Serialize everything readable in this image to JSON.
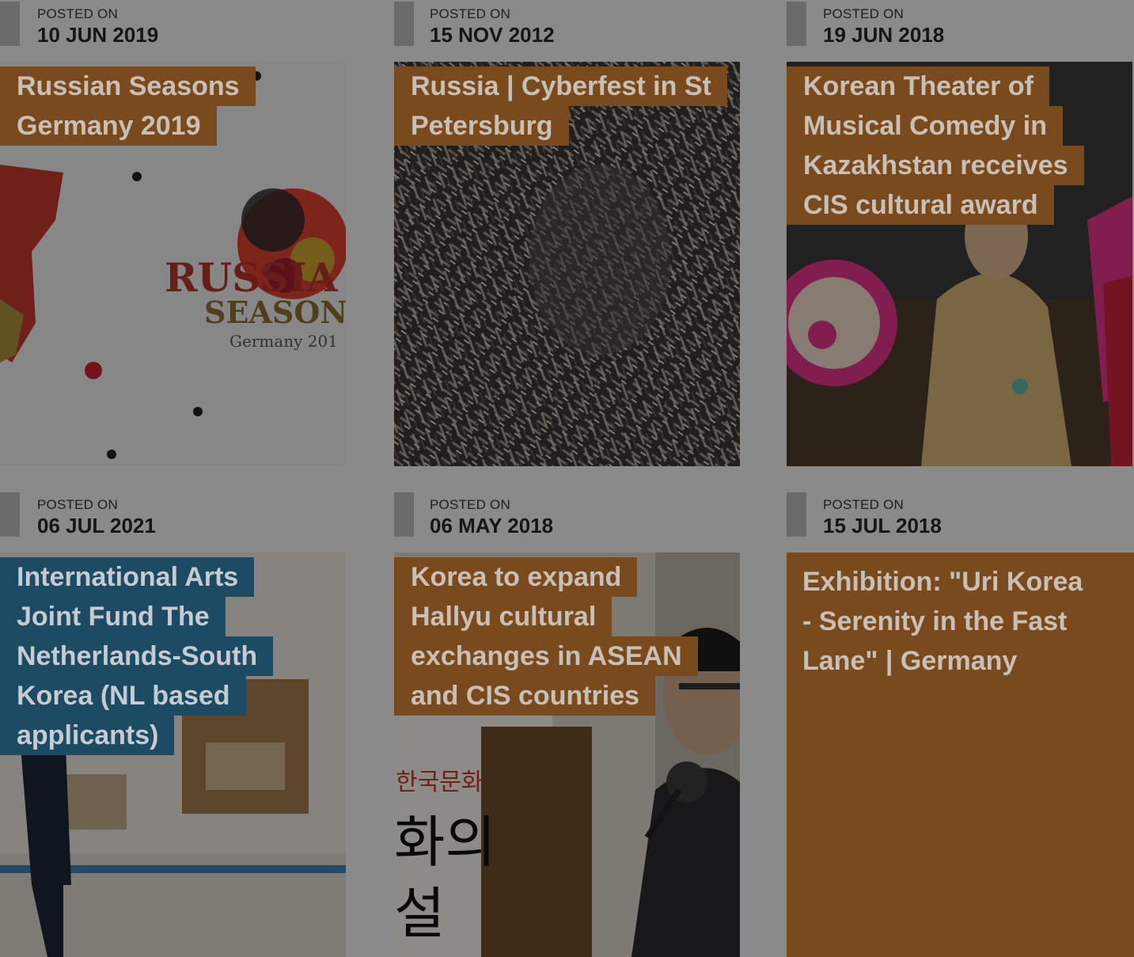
{
  "posts": [
    {
      "posted_label": "POSTED ON",
      "date": "10 JUN 2019",
      "title_lines": [
        "Russian Seasons",
        "Germany 2019"
      ],
      "image_icon": "russian-seasons-logo-image",
      "logo_text": [
        "RUSSIA",
        "SEASON",
        "Germany 201"
      ]
    },
    {
      "posted_label": "POSTED ON",
      "date": "15 NOV 2012",
      "title_lines": [
        "Russia | Cyberfest in St",
        "Petersburg"
      ],
      "image_icon": "cyberfest-abstract-image"
    },
    {
      "posted_label": "POSTED ON",
      "date": "19 JUN 2018",
      "title_lines": [
        "Korean Theater of",
        "Musical Comedy in",
        "Kazakhstan receives",
        "CIS cultural award"
      ],
      "image_icon": "fan-dancer-image"
    },
    {
      "posted_label": "POSTED ON",
      "date": "06 JUL 2021",
      "title_lines": [
        "International Arts",
        "Joint Fund The",
        "Netherlands-South",
        "Korea (NL based",
        "applicants)"
      ],
      "image_icon": "gallery-room-image"
    },
    {
      "posted_label": "POSTED ON",
      "date": "06 MAY 2018",
      "title_lines": [
        "Korea to expand",
        "Hallyu cultural",
        "exchanges in ASEAN",
        "and CIS countries"
      ],
      "image_icon": "speaker-at-podium-image",
      "banner_text": [
        "한국문화",
        "화의",
        "설"
      ]
    },
    {
      "posted_label": "POSTED ON",
      "date": "15 JUL 2018",
      "title_lines": [
        "Exhibition: \"Uri Korea",
        "- Serenity in the Fast",
        "Lane\" | Germany"
      ]
    }
  ],
  "colors": {
    "title_bg": "#7a4a1f",
    "title_bg_blue": "#1e4b64",
    "page_bg": "#8a8a8a"
  }
}
